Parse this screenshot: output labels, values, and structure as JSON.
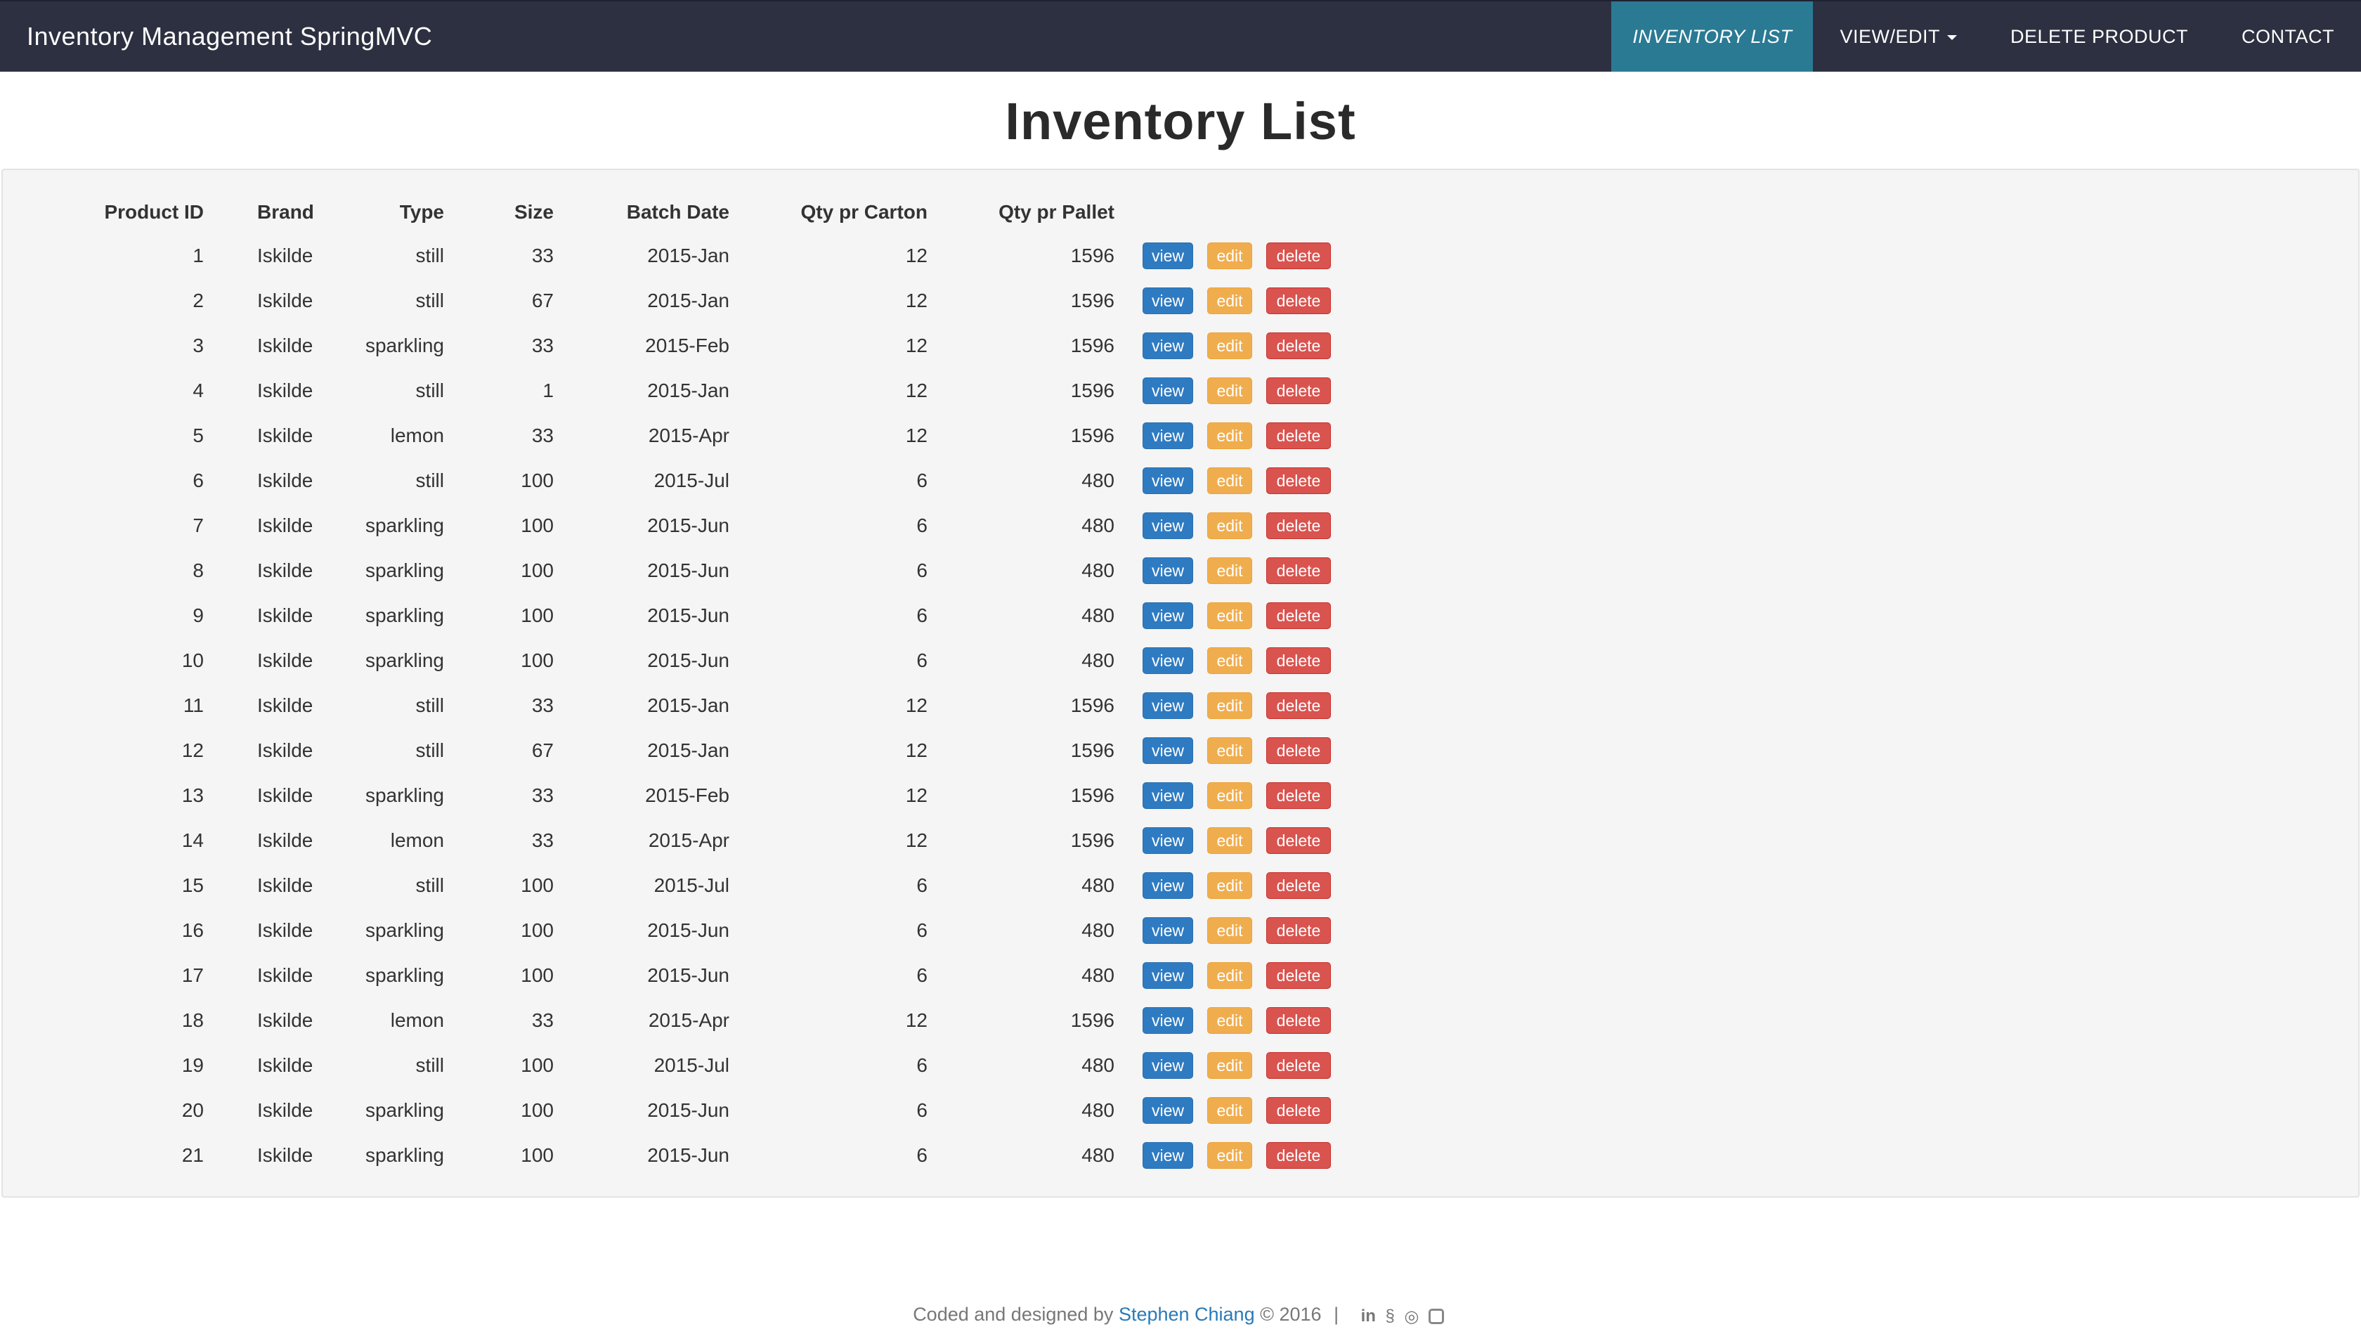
{
  "navbar": {
    "brand": "Inventory Management SpringMVC",
    "items": [
      {
        "label": "INVENTORY LIST",
        "active": true
      },
      {
        "label": "VIEW/EDIT",
        "dropdown": true
      },
      {
        "label": "DELETE PRODUCT"
      },
      {
        "label": "CONTACT"
      }
    ]
  },
  "page": {
    "title": "Inventory List"
  },
  "table": {
    "headers": [
      "Product ID",
      "Brand",
      "Type",
      "Size",
      "Batch Date",
      "Qty pr Carton",
      "Qty pr Pallet"
    ],
    "actions": {
      "view": "view",
      "edit": "edit",
      "delete": "delete"
    },
    "rows": [
      [
        "1",
        "Iskilde",
        "still",
        "33",
        "2015-Jan",
        "12",
        "1596"
      ],
      [
        "2",
        "Iskilde",
        "still",
        "67",
        "2015-Jan",
        "12",
        "1596"
      ],
      [
        "3",
        "Iskilde",
        "sparkling",
        "33",
        "2015-Feb",
        "12",
        "1596"
      ],
      [
        "4",
        "Iskilde",
        "still",
        "1",
        "2015-Jan",
        "12",
        "1596"
      ],
      [
        "5",
        "Iskilde",
        "lemon",
        "33",
        "2015-Apr",
        "12",
        "1596"
      ],
      [
        "6",
        "Iskilde",
        "still",
        "100",
        "2015-Jul",
        "6",
        "480"
      ],
      [
        "7",
        "Iskilde",
        "sparkling",
        "100",
        "2015-Jun",
        "6",
        "480"
      ],
      [
        "8",
        "Iskilde",
        "sparkling",
        "100",
        "2015-Jun",
        "6",
        "480"
      ],
      [
        "9",
        "Iskilde",
        "sparkling",
        "100",
        "2015-Jun",
        "6",
        "480"
      ],
      [
        "10",
        "Iskilde",
        "sparkling",
        "100",
        "2015-Jun",
        "6",
        "480"
      ],
      [
        "11",
        "Iskilde",
        "still",
        "33",
        "2015-Jan",
        "12",
        "1596"
      ],
      [
        "12",
        "Iskilde",
        "still",
        "67",
        "2015-Jan",
        "12",
        "1596"
      ],
      [
        "13",
        "Iskilde",
        "sparkling",
        "33",
        "2015-Feb",
        "12",
        "1596"
      ],
      [
        "14",
        "Iskilde",
        "lemon",
        "33",
        "2015-Apr",
        "12",
        "1596"
      ],
      [
        "15",
        "Iskilde",
        "still",
        "100",
        "2015-Jul",
        "6",
        "480"
      ],
      [
        "16",
        "Iskilde",
        "sparkling",
        "100",
        "2015-Jun",
        "6",
        "480"
      ],
      [
        "17",
        "Iskilde",
        "sparkling",
        "100",
        "2015-Jun",
        "6",
        "480"
      ],
      [
        "18",
        "Iskilde",
        "lemon",
        "33",
        "2015-Apr",
        "12",
        "1596"
      ],
      [
        "19",
        "Iskilde",
        "still",
        "100",
        "2015-Jul",
        "6",
        "480"
      ],
      [
        "20",
        "Iskilde",
        "sparkling",
        "100",
        "2015-Jun",
        "6",
        "480"
      ],
      [
        "21",
        "Iskilde",
        "sparkling",
        "100",
        "2015-Jun",
        "6",
        "480"
      ]
    ]
  },
  "footer": {
    "prefix": "Coded and designed by",
    "author": "Stephen Chiang",
    "suffix": "© 2016",
    "separator": "|",
    "social_icons": [
      "linkedin-icon",
      "stackoverflow-icon",
      "github-icon",
      "instagram-icon"
    ],
    "linkedin_glyph": "in",
    "stackoverflow_glyph": "§",
    "github_glyph": "◎"
  },
  "colors": {
    "navbar_bg": "#2c3040",
    "nav_active_bg": "#2a7a94",
    "btn_view": "#2f7bc1",
    "btn_edit": "#f0ad4e",
    "btn_delete": "#d9534f",
    "panel_bg": "#f5f5f5",
    "footer_link": "#2a7ab8"
  }
}
